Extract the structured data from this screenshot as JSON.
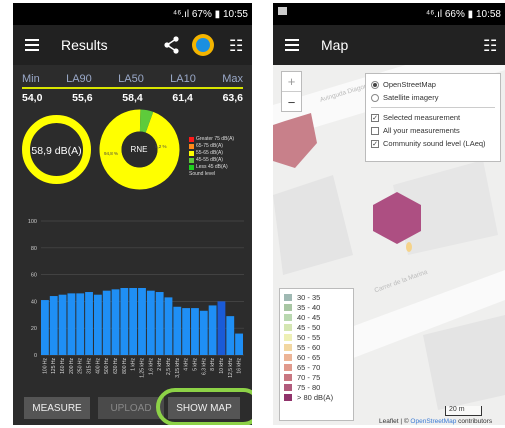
{
  "results_screen": {
    "status": {
      "signal": "⁴⁶.ıl",
      "battery": "67%",
      "time": "10:55"
    },
    "title": "Results",
    "stats_headers": [
      "Min",
      "LA90",
      "LA50",
      "LA10",
      "Max"
    ],
    "stats_values": [
      "54,0",
      "55,6",
      "58,4",
      "61,4",
      "63,6"
    ],
    "leq_value": "58,9 dB(A)",
    "donut_center": "RNE",
    "donut_label_main": "94,8 %",
    "donut_label_slice": "5,2 %",
    "donut_data": [
      {
        "name": "55-65 dB(A)",
        "fraction": 0.948,
        "color": "#ffff00"
      },
      {
        "name": "45-55 dB(A)",
        "fraction": 0.052,
        "color": "#5ecb3b"
      }
    ],
    "legend": [
      {
        "label": "Greater 75 dB(A)",
        "color": "#ff1a1a"
      },
      {
        "label": "65-75 dB(A)",
        "color": "#ff8a1a"
      },
      {
        "label": "55-65 dB(A)",
        "color": "#ffff00"
      },
      {
        "label": "45-55 dB(A)",
        "color": "#5ecb3b"
      },
      {
        "label": "Less 45 dB(A)",
        "color": "#1fd01f"
      }
    ],
    "legend_title": "Sound level",
    "buttons": {
      "measure": "MEASURE",
      "upload": "UPLOAD",
      "show_map": "SHOW MAP"
    }
  },
  "chart_data": {
    "type": "bar",
    "categories": [
      "100 Hz",
      "125 Hz",
      "160 Hz",
      "200 Hz",
      "250 Hz",
      "315 Hz",
      "400 Hz",
      "500 Hz",
      "630 Hz",
      "800 Hz",
      "1 kHz",
      "1,25 kHz",
      "1,6 kHz",
      "2 kHz",
      "2,5 kHz",
      "3,15 kHz",
      "4 kHz",
      "5 kHz",
      "6,3 kHz",
      "8 kHz",
      "10 kHz",
      "12,5 kHz",
      "16 kHz"
    ],
    "values": [
      41,
      44,
      45,
      46,
      46,
      47,
      45,
      48,
      49,
      50,
      50,
      50,
      48,
      47,
      43,
      36,
      35,
      35,
      33,
      37,
      40,
      29,
      16
    ],
    "highlight_index": 20,
    "ylim": [
      0,
      100
    ],
    "yticks": [
      "0",
      "20",
      "40",
      "60",
      "80",
      "100"
    ],
    "grid": true,
    "colors": {
      "bar": "#1f8ff5",
      "highlight": "#1a5bd8"
    }
  },
  "map_screen": {
    "status": {
      "signal": "⁴⁶.ıl",
      "battery": "66%",
      "time": "10:58"
    },
    "title": "Map",
    "zoom": {
      "in": "+",
      "out": "−"
    },
    "layers": [
      {
        "label": "OpenStreetMap",
        "type": "radio",
        "checked": true
      },
      {
        "label": "Satellite imagery",
        "type": "radio",
        "checked": false
      },
      {
        "label": "Selected measurement",
        "type": "checkbox",
        "checked": true
      },
      {
        "label": "All your measurements",
        "type": "checkbox",
        "checked": false
      },
      {
        "label": "Community sound level (LAeq)",
        "type": "checkbox",
        "checked": true
      }
    ],
    "street_labels": [
      "Avinguda Diagonal",
      "Carrer de la Marina"
    ],
    "legend": [
      {
        "label": "30 - 35",
        "color": "#9fb9b3"
      },
      {
        "label": "35 - 40",
        "color": "#a8c6a3"
      },
      {
        "label": "40 - 45",
        "color": "#b9d8b0"
      },
      {
        "label": "45 - 50",
        "color": "#d4e6b2"
      },
      {
        "label": "50 - 55",
        "color": "#eef0b5"
      },
      {
        "label": "55 - 60",
        "color": "#f2d7a1"
      },
      {
        "label": "60 - 65",
        "color": "#ecb496"
      },
      {
        "label": "65 - 70",
        "color": "#e0998c"
      },
      {
        "label": "70 - 75",
        "color": "#c87681"
      },
      {
        "label": "75 - 80",
        "color": "#b15b7c"
      },
      {
        "label": "> 80 dB(A)",
        "color": "#90336b"
      }
    ],
    "scale_label": "20 m",
    "attribution_prefix": "Leaflet | © ",
    "attribution_link": "OpenStreetMap",
    "attribution_suffix": " contributors"
  }
}
